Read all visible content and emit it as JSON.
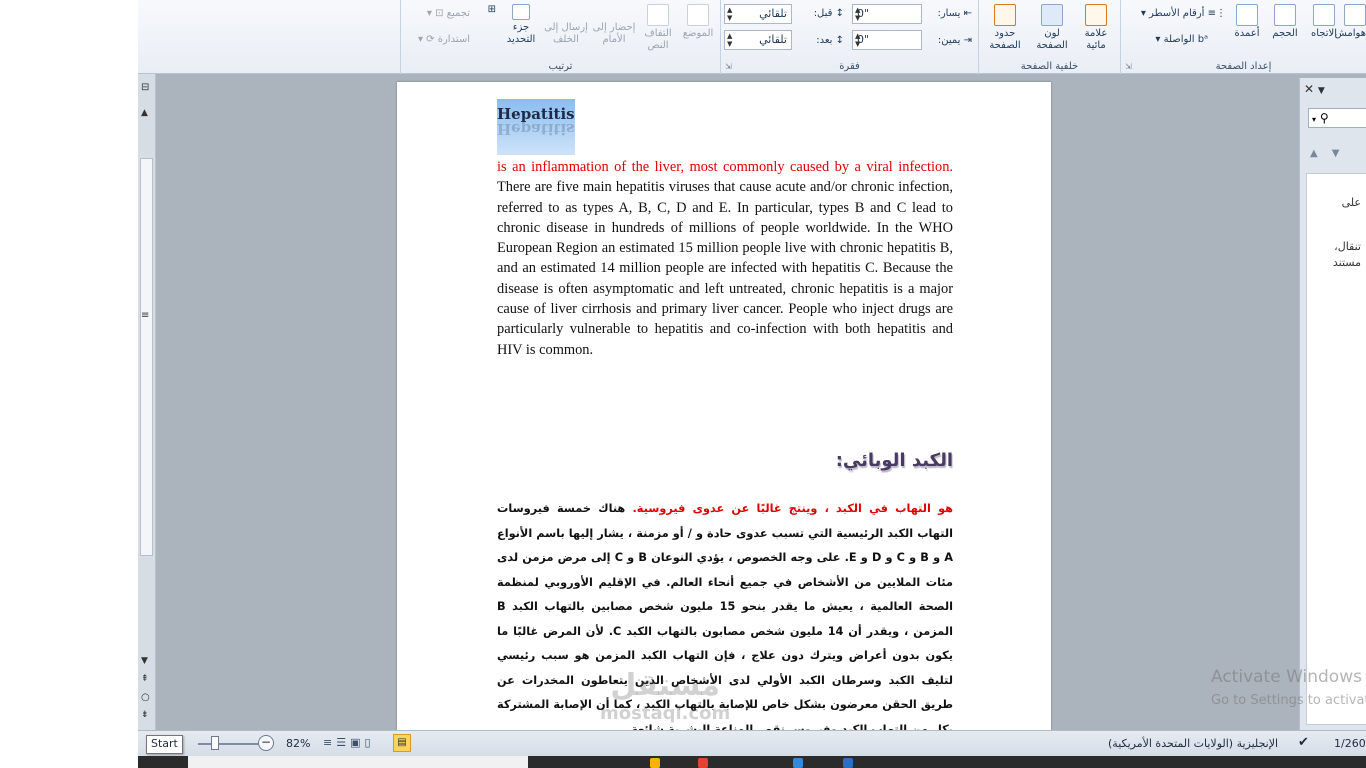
{
  "ribbon": {
    "groups": {
      "page_setup": {
        "label": "إعداد الصفحة",
        "columns": "أعمدة",
        "size": "الحجم",
        "orientation": "الاتجاه",
        "margins": "هوامش",
        "line_numbers": "أرقام الأسطر",
        "hyphenation": "الواصلة"
      },
      "page_background": {
        "label": "خلفية الصفحة",
        "watermark": "علامة مائية",
        "page_color": "لون الصفحة",
        "page_borders": "حدود الصفحة"
      },
      "paragraph": {
        "label": "فقرة",
        "indent_left": "يسار:",
        "indent_left_value": "0\"",
        "indent_right": "يمين:",
        "indent_right_value": "0\"",
        "spacing_before": "قبل:",
        "spacing_before_value": "تلقائي",
        "spacing_after": "بعد:",
        "spacing_after_value": "تلقائي"
      },
      "arrange": {
        "label": "ترتيب",
        "position": "الموضع",
        "wrap_text": "التفاف النص",
        "bring_forward": "إحضار إلى الأمام",
        "send_backward": "إرسال إلى الخلف",
        "selection_pane": "جزء التحديد",
        "align": "محاذاة",
        "group": "تجميع",
        "rotate": "استدارة"
      }
    }
  },
  "document": {
    "heading_en": "Hepatitis",
    "paragraph_en_red": "is an inflammation of the liver, most commonly caused by a viral infection.",
    "paragraph_en_rest": " There are five main hepatitis viruses that cause acute and/or chronic infection, referred to as types A, B, C, D and E. In particular, types B and C lead to chronic disease in hundreds of millions of people worldwide. In the WHO European Region an estimated 15 million people live with chronic hepatitis B, and an estimated 14 million people are infected with hepatitis C. Because the disease is often asymptomatic and left untreated, chronic hepatitis is a major cause of liver cirrhosis and primary liver cancer. People who inject drugs are particularly vulnerable to hepatitis and co-infection with both hepatitis and HIV is common.",
    "heading_ar": "الكبد الوبائي:",
    "paragraph_ar_red": "هو التهاب في الكبد ، وينتج غالبًا عن عدوى فيروسية.",
    "paragraph_ar_rest": " هناك خمسة فيروسات التهاب الكبد الرئيسية التي تسبب عدوى حادة و / أو مزمنة ، يشار إليها باسم الأنواع A و B و C و D و E. على وجه الخصوص ، يؤدي النوعان B و C إلى مرض مزمن لدى مئات الملايين من الأشخاص في جميع أنحاء العالم. في الإقليم الأوروبي لمنظمة الصحة العالمية ، يعيش ما يقدر بنحو 15 مليون شخص مصابين بالتهاب الكبد B المزمن ، ويقدر أن 14 مليون شخص مصابون بالتهاب الكبد C. لأن المرض غالبًا ما يكون بدون أعراض ويترك دون علاج ، فإن التهاب الكبد المزمن هو سبب رئيسي لتليف الكبد وسرطان الكبد الأولي لدى الأشخاص الذين يتعاطون المخدرات عن طريق الحقن معرضون بشكل خاص للإصابة بالتهاب الكبد ، كما أن الإصابة المشتركة بكل من التهاب الكبد وفيروس نقص المناعة البشرية شائعة."
  },
  "nav_pane": {
    "line1": "على",
    "line2": "تنقال،",
    "line3": "مستند"
  },
  "status_bar": {
    "page": "1/260",
    "language": "الإنجليزية (الولايات المتحدة الأمريكية)",
    "zoom": "82%",
    "start_tooltip": "Start"
  },
  "overlay": {
    "activate_title": "Activate Windows",
    "activate_sub": "Go to Settings to activate",
    "watermark_ar": "مستقل",
    "watermark_en": "mostaql.com"
  },
  "colors": {
    "red_text": "#e00000",
    "ribbon_bg": "#e9eef5",
    "workspace": "#abb3bd"
  }
}
